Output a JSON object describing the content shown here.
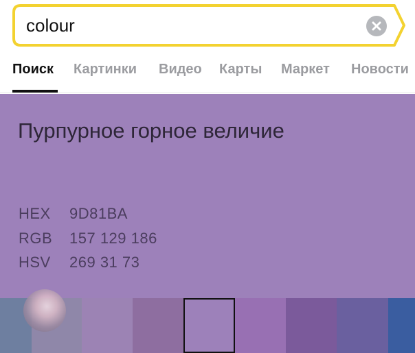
{
  "search": {
    "query": "colour",
    "accent_color": "#F3D230",
    "clear_icon": "close-circle-icon"
  },
  "tabs": [
    {
      "label": "Поиск",
      "active": true
    },
    {
      "label": "Картинки",
      "active": false
    },
    {
      "label": "Видео",
      "active": false
    },
    {
      "label": "Карты",
      "active": false
    },
    {
      "label": "Маркет",
      "active": false
    },
    {
      "label": "Новости",
      "active": false
    }
  ],
  "colour": {
    "name": "Пурпурное горное величие",
    "background": "#9D81BA",
    "codes": [
      {
        "label": "HEX",
        "value": "9D81BA"
      },
      {
        "label": "RGB",
        "value": "157 129 186"
      },
      {
        "label": "HSV",
        "value": "269 31 73"
      }
    ]
  },
  "palette": [
    {
      "color": "#6E7FA0",
      "selected": false
    },
    {
      "color": "#8F87A9",
      "selected": false
    },
    {
      "color": "#9C83B4",
      "selected": false
    },
    {
      "color": "#8E6EA0",
      "selected": false
    },
    {
      "color": "#9D81BA",
      "selected": true
    },
    {
      "color": "#9870B3",
      "selected": false
    },
    {
      "color": "#7B5A9B",
      "selected": false
    },
    {
      "color": "#6A609F",
      "selected": false
    },
    {
      "color": "#3A5DA0",
      "selected": false
    }
  ]
}
